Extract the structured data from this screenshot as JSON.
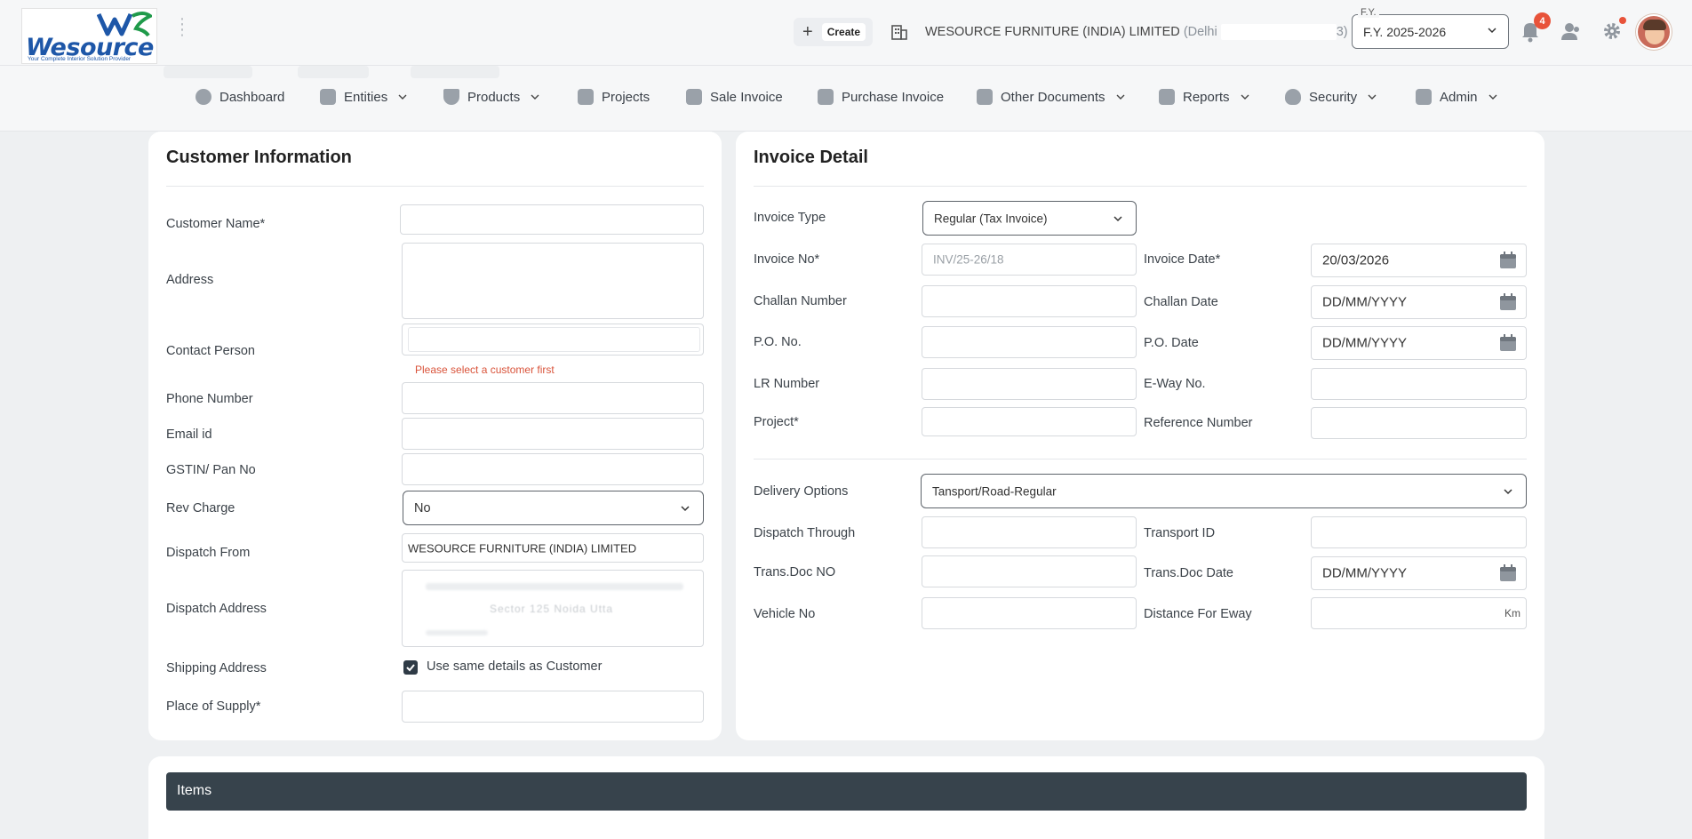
{
  "header": {
    "logo_text": "Wesource",
    "logo_tagline": "Your Complete Interior Solution Provider",
    "create_label": "Create",
    "company_name": "WESOURCE FURNITURE (INDIA) LIMITED",
    "company_location": "(Delhi",
    "company_suffix": "3)",
    "fy_caption": "F.Y.",
    "fy_value": "F.Y. 2025-2026",
    "notification_count": "4"
  },
  "nav": {
    "items": [
      {
        "label": "Dashboard",
        "icon": "dashboard-icon"
      },
      {
        "label": "Entities",
        "icon": "entities-icon"
      },
      {
        "label": "Products",
        "icon": "products-icon"
      },
      {
        "label": "Projects",
        "icon": "projects-icon"
      },
      {
        "label": "Sale Invoice",
        "icon": "sale-invoice-icon"
      },
      {
        "label": "Purchase Invoice",
        "icon": "purchase-invoice-icon"
      },
      {
        "label": "Other Documents",
        "icon": "other-documents-icon"
      },
      {
        "label": "Reports",
        "icon": "reports-icon"
      },
      {
        "label": "Security",
        "icon": "security-icon"
      },
      {
        "label": "Admin",
        "icon": "admin-icon"
      }
    ]
  },
  "customer": {
    "title": "Customer Information",
    "customer_name_label": "Customer Name*",
    "customer_name_value": "",
    "address_label": "Address",
    "contact_person_label": "Contact Person",
    "contact_error": "Please select a customer first",
    "phone_label": "Phone Number",
    "email_label": "Email id",
    "gstin_label": "GSTIN/ Pan No",
    "rev_charge_label": "Rev Charge",
    "rev_charge_value": "No",
    "dispatch_from_label": "Dispatch From",
    "dispatch_from_value": "WESOURCE FURNITURE (INDIA) LIMITED",
    "dispatch_address_label": "Dispatch Address",
    "dispatch_address_line2": "Sector 125 Noida Utta",
    "shipping_address_label": "Shipping Address",
    "shipping_same_label": "Use same details as Customer",
    "shipping_same_checked": true,
    "place_of_supply_label": "Place of Supply*"
  },
  "invoice": {
    "title": "Invoice Detail",
    "invoice_type_label": "Invoice Type",
    "invoice_type_value": "Regular (Tax Invoice)",
    "invoice_no_label": "Invoice No*",
    "invoice_no_placeholder": "INV/25-26/18",
    "invoice_date_label": "Invoice Date*",
    "invoice_date_value": "20/03/2026",
    "challan_number_label": "Challan Number",
    "challan_date_label": "Challan Date",
    "date_placeholder": "DD/MM/YYYY",
    "po_no_label": "P.O. No.",
    "po_date_label": "P.O. Date",
    "lr_number_label": "LR Number",
    "eway_no_label": "E-Way No.",
    "project_label": "Project*",
    "reference_number_label": "Reference Number",
    "delivery_options_label": "Delivery Options",
    "delivery_options_value": "Tansport/Road-Regular",
    "dispatch_through_label": "Dispatch Through",
    "transport_id_label": "Transport ID",
    "trans_doc_no_label": "Trans.Doc NO",
    "trans_doc_date_label": "Trans.Doc Date",
    "vehicle_no_label": "Vehicle No",
    "distance_label": "Distance For Eway",
    "distance_unit": "Km"
  },
  "items": {
    "title": "Items"
  }
}
